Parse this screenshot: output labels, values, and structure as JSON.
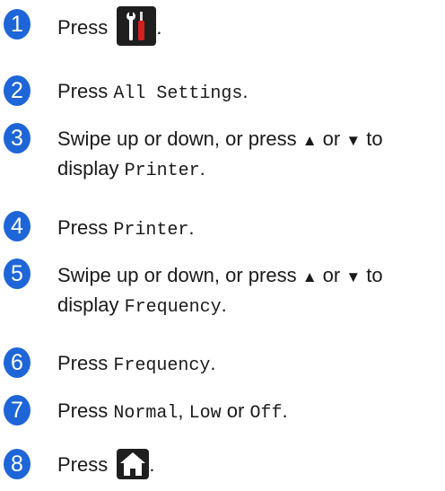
{
  "steps": [
    {
      "number": "1",
      "press": "Press",
      "end": "."
    },
    {
      "number": "2",
      "press": "Press",
      "setting": "All Settings",
      "end": "."
    },
    {
      "number": "3",
      "line1": "Swipe up or down, or press",
      "up": "▲",
      "or1": "or",
      "down": "▼",
      "to": "to",
      "display": "display",
      "setting": "Printer",
      "end": "."
    },
    {
      "number": "4",
      "press": "Press",
      "setting": "Printer",
      "end": "."
    },
    {
      "number": "5",
      "line1": "Swipe up or down, or press",
      "up": "▲",
      "or1": "or",
      "down": "▼",
      "to": "to",
      "display": "display",
      "setting": "Frequency",
      "end": "."
    },
    {
      "number": "6",
      "press": "Press",
      "setting": "Frequency",
      "end": "."
    },
    {
      "number": "7",
      "press": "Press",
      "opt1": "Normal",
      "comma": ",",
      "opt2": "Low",
      "or": "or",
      "opt3": "Off",
      "end": "."
    },
    {
      "number": "8",
      "press": "Press",
      "end": "."
    }
  ],
  "icons": {
    "settings": "tools-settings-icon",
    "home": "home-icon"
  },
  "colors": {
    "step_badge": "#1e66d8",
    "icon_background": "#1f1f1f",
    "tool_red": "#d42020"
  }
}
